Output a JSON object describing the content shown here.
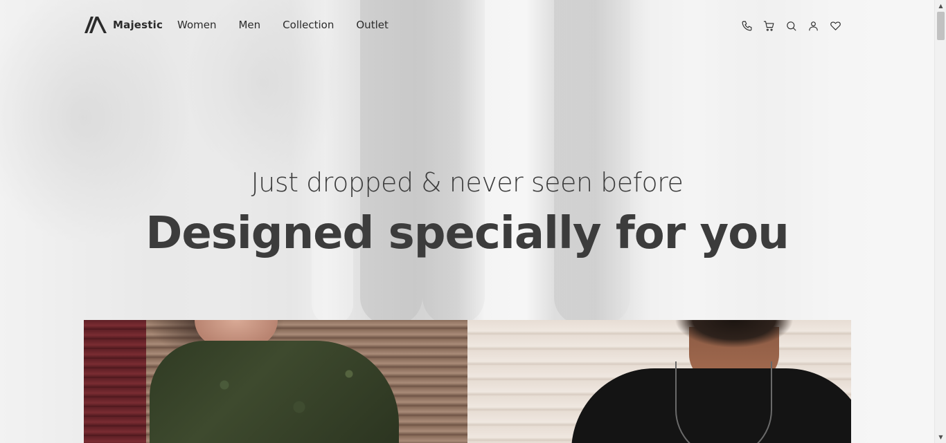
{
  "header": {
    "brand": "Majestic",
    "nav": [
      {
        "label": "Women"
      },
      {
        "label": "Men"
      },
      {
        "label": "Collection"
      },
      {
        "label": "Outlet"
      }
    ],
    "icons": [
      "phone-icon",
      "cart-icon",
      "search-icon",
      "user-icon",
      "heart-icon"
    ]
  },
  "hero": {
    "subtitle": "Just dropped & never seen before",
    "title": "Designed specially for you"
  },
  "tiles": [
    {
      "name": "women-collection-image"
    },
    {
      "name": "men-collection-image"
    }
  ],
  "colors": {
    "text": "#3c3c3c",
    "nav_text": "#2b2b2b"
  }
}
